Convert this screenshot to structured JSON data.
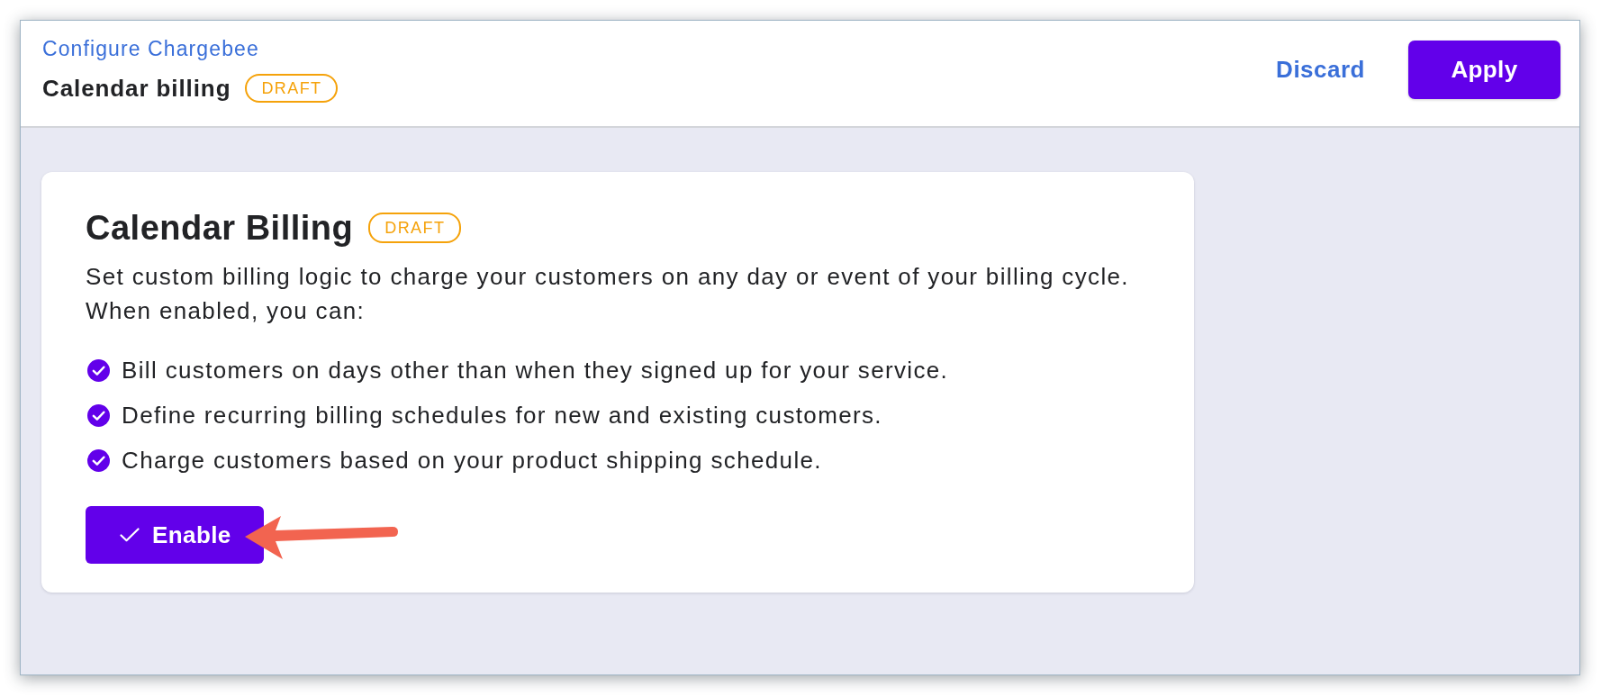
{
  "header": {
    "breadcrumb": "Configure Chargebee",
    "title": "Calendar billing",
    "badge": "DRAFT",
    "actions": [
      {
        "label": "Discard",
        "kind": "link"
      },
      {
        "label": "Apply",
        "kind": "primary"
      }
    ]
  },
  "card": {
    "title": "Calendar Billing",
    "badge": "DRAFT",
    "description": "Set custom billing logic to charge your customers on any day or event of your billing cycle.",
    "lead_in": "When enabled, you can:",
    "features": [
      "Bill customers on days other than when they signed up for your service.",
      "Define recurring billing schedules for new and existing customers.",
      "Charge customers based on your product shipping schedule."
    ],
    "button": {
      "label": "Enable"
    }
  }
}
